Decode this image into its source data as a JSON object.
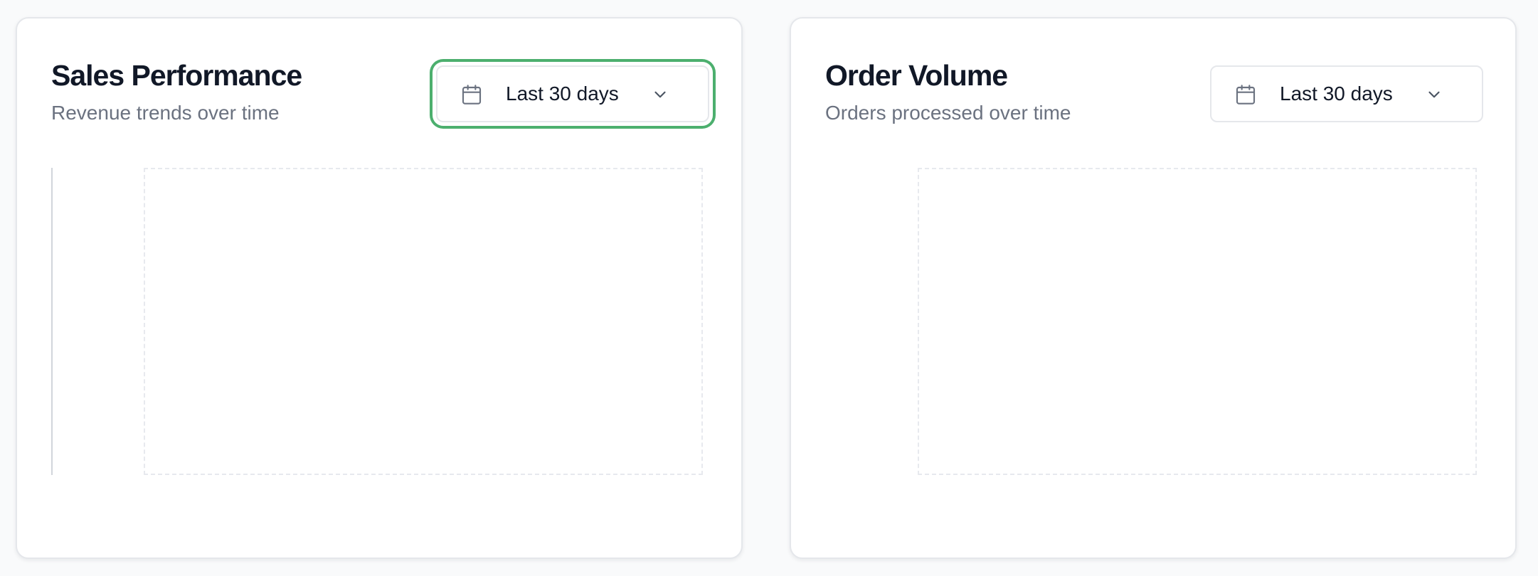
{
  "cards": [
    {
      "title": "Sales Performance",
      "subtitle": "Revenue trends over time",
      "date_range": {
        "label": "Last 30 days",
        "icon": "calendar-icon",
        "dropdown_icon": "chevron-down-icon",
        "focused": true
      }
    },
    {
      "title": "Order Volume",
      "subtitle": "Orders processed over time",
      "date_range": {
        "label": "Last 30 days",
        "icon": "calendar-icon",
        "dropdown_icon": "chevron-down-icon",
        "focused": false
      }
    }
  ],
  "colors": {
    "focus_ring": "#4caf6e",
    "title_text": "#111827",
    "subtitle_text": "#6b7280",
    "card_border": "#e5e7eb"
  }
}
